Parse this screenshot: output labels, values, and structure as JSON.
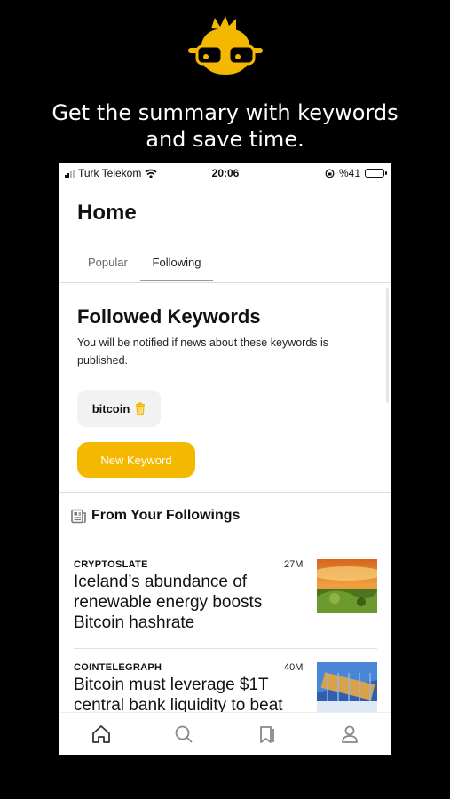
{
  "promo": {
    "tagline_line1": "Get the summary with keywords",
    "tagline_line2": "and save time.",
    "accent_color": "#f5b800"
  },
  "status_bar": {
    "carrier": "Turk Telekom",
    "time": "20:06",
    "battery": "%41",
    "battery_level": 0.41
  },
  "header": {
    "title": "Home"
  },
  "tabs": [
    {
      "label": "Popular",
      "active": false
    },
    {
      "label": "Following",
      "active": true
    }
  ],
  "followed": {
    "title": "Followed Keywords",
    "description": "You will be notified if news about these keywords is published.",
    "keywords": [
      {
        "label": "bitcoin",
        "icon": "trash-icon"
      }
    ],
    "new_button": "New Keyword"
  },
  "feed": {
    "section_title": "From Your Followings",
    "section_icon": "newspaper-icon",
    "items": [
      {
        "source": "CRYPTOSLATE",
        "age": "27M",
        "headline": "Iceland’s abundance of renewable energy boosts Bitcoin hashrate"
      },
      {
        "source": "COINTELEGRAPH",
        "age": "40M",
        "headline": "Bitcoin must leverage $1T central bank liquidity to beat"
      }
    ]
  },
  "bottom_nav": [
    {
      "icon": "home-icon"
    },
    {
      "icon": "search-icon"
    },
    {
      "icon": "bookmark-icon"
    },
    {
      "icon": "profile-icon"
    }
  ]
}
